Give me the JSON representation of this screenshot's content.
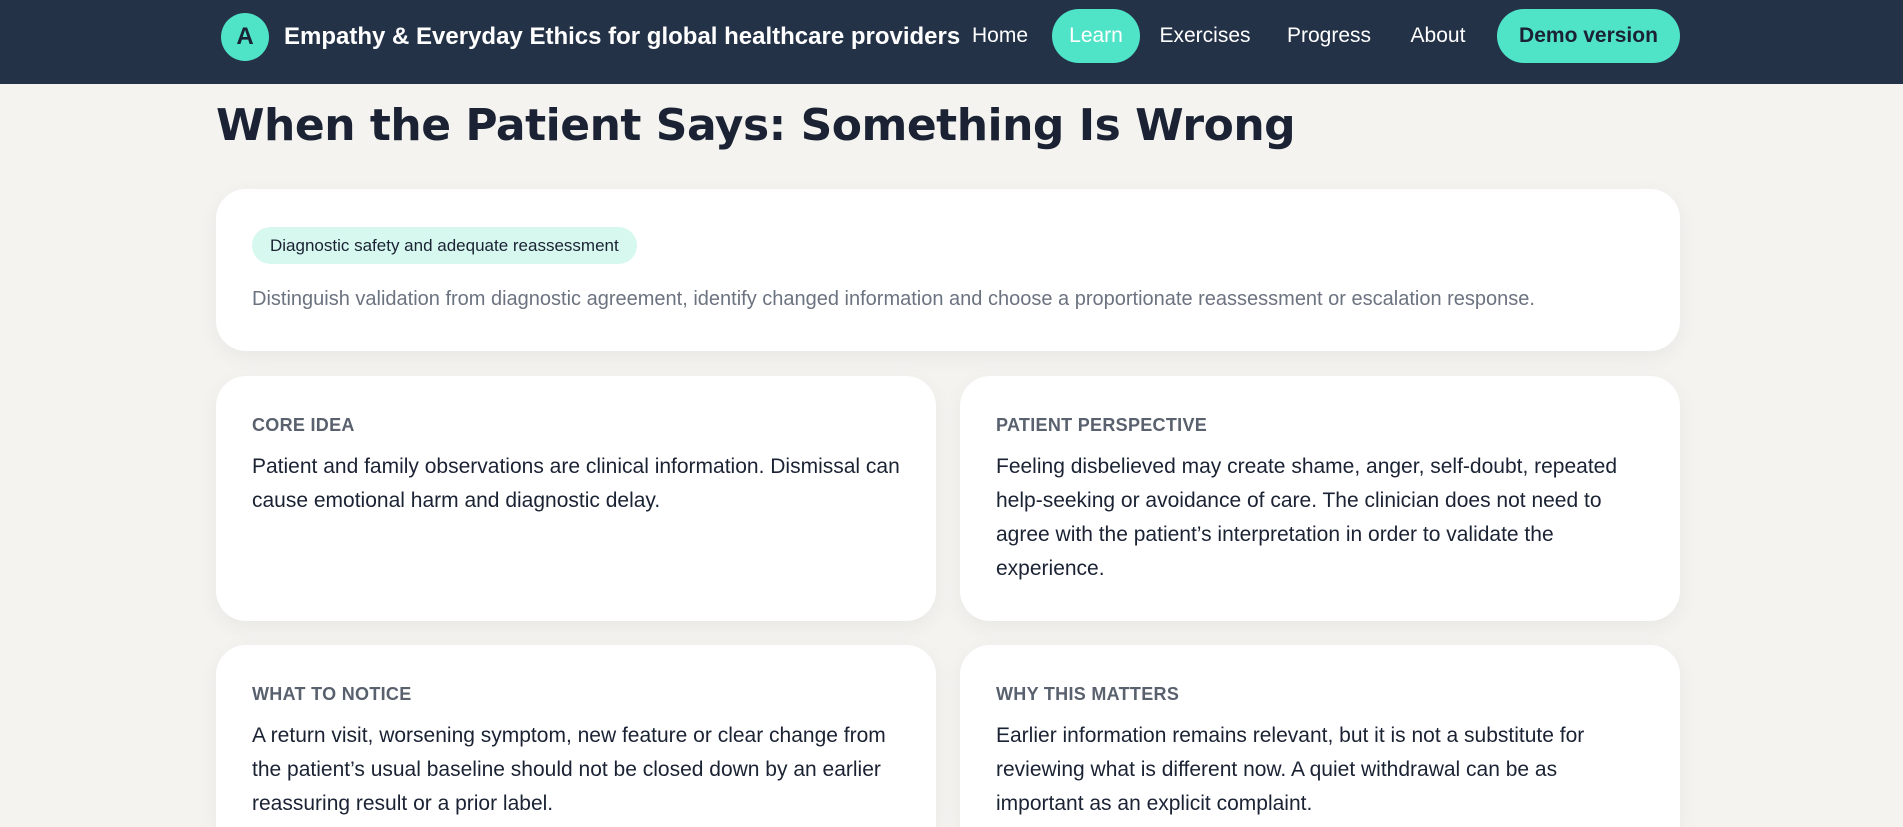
{
  "header": {
    "logo_letter": "A",
    "title": "Empathy & Everyday Ethics for global healthcare providers",
    "nav": [
      {
        "label": "Home"
      },
      {
        "label": "Learn"
      },
      {
        "label": "Exercises"
      },
      {
        "label": "Progress"
      },
      {
        "label": "About"
      }
    ],
    "active_nav": "Learn",
    "demo_label": "Demo version"
  },
  "page": {
    "title": "When the Patient Says: Something Is Wrong"
  },
  "summary_card": {
    "tag": "Diagnostic safety and adequate reassessment",
    "text": "Distinguish validation from diagnostic agreement, identify changed information and choose a proportionate reassessment or escalation response."
  },
  "cards": [
    {
      "heading": "CORE IDEA",
      "body": "Patient and family observations are clinical information. Dismissal can cause emotional harm and diagnostic delay."
    },
    {
      "heading": "PATIENT PERSPECTIVE",
      "body": "Feeling disbelieved may create shame, anger, self-doubt, repeated help-seeking or avoidance of care. The clinician does not need to agree with the patient’s interpretation in order to validate the experience."
    },
    {
      "heading": "WHAT TO NOTICE",
      "body": "A return visit, worsening symptom, new feature or clear change from the patient’s usual baseline should not be closed down by an earlier reassuring result or a prior label."
    },
    {
      "heading": "WHY THIS MATTERS",
      "body": "Earlier information remains relevant, but it is not a substitute for reviewing what is different now. A quiet withdrawal can be as important as an explicit complaint."
    }
  ],
  "colors": {
    "header_bg": "#243248",
    "accent": "#4fe3c8",
    "page_bg": "#f4f3f0",
    "tag_bg": "#d7f8ef"
  }
}
